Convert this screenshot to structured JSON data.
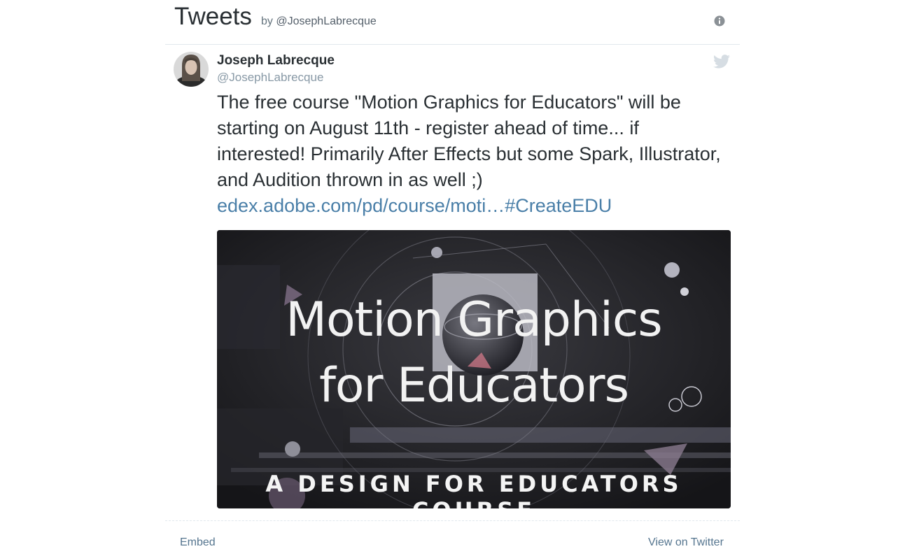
{
  "header": {
    "title": "Tweets",
    "by_label": "by",
    "handle": "@JosephLabrecque",
    "info_icon": "info-icon"
  },
  "tweet": {
    "author_name": "Joseph Labrecque",
    "author_handle": "@JosephLabrecque",
    "platform_icon": "twitter-bird-icon",
    "text": "The free course \"Motion Graphics for Educators\" will be starting on August 11th - register ahead of time...  if interested! Primarily After Effects but some Spark, Illustrator, and Audition thrown in as well ;)",
    "link_text": "edex.adobe.com/pd/course/moti…",
    "hashtag": "#CreateEDU",
    "media": {
      "title_line1": "Motion Graphics",
      "title_line2": "for Educators",
      "subtitle": "A DESIGN FOR EDUCATORS COURSE"
    }
  },
  "footer": {
    "embed_label": "Embed",
    "view_label": "View on Twitter"
  },
  "colors": {
    "text": "#292f33",
    "muted": "#8899a6",
    "link": "#4a7fa8",
    "border": "#e1e8ed"
  }
}
